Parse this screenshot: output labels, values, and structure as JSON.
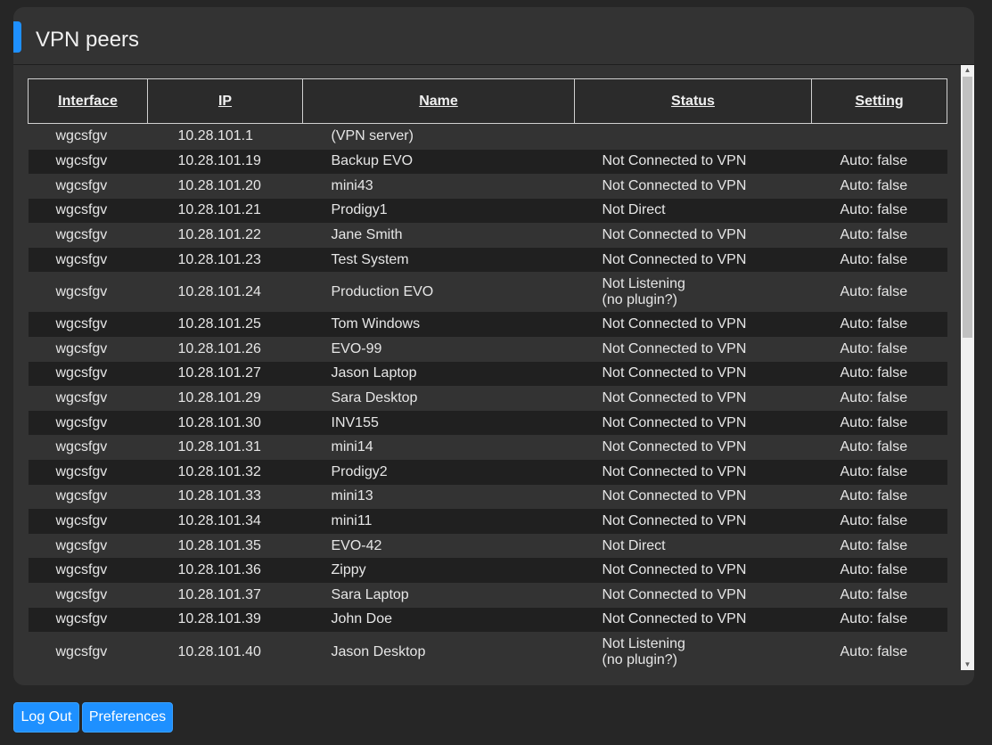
{
  "colors": {
    "accent": "#1e90ff",
    "button": "#1e90ff"
  },
  "panel": {
    "title": "VPN peers"
  },
  "table": {
    "headers": [
      "Interface",
      "IP",
      "Name",
      "Status",
      "Setting"
    ],
    "rows": [
      [
        "wgcsfgv",
        "10.28.101.1",
        "(VPN server)",
        "",
        ""
      ],
      [
        "wgcsfgv",
        "10.28.101.19",
        "Backup EVO",
        "Not Connected to VPN",
        "Auto: false"
      ],
      [
        "wgcsfgv",
        "10.28.101.20",
        "mini43",
        "Not Connected to VPN",
        "Auto: false"
      ],
      [
        "wgcsfgv",
        "10.28.101.21",
        "Prodigy1",
        "Not Direct",
        "Auto: false"
      ],
      [
        "wgcsfgv",
        "10.28.101.22",
        "Jane Smith",
        "Not Connected to VPN",
        "Auto: false"
      ],
      [
        "wgcsfgv",
        "10.28.101.23",
        "Test System",
        "Not Connected to VPN",
        "Auto: false"
      ],
      [
        "wgcsfgv",
        "10.28.101.24",
        "Production EVO",
        "Not Listening (no plugin?)",
        "Auto: false"
      ],
      [
        "wgcsfgv",
        "10.28.101.25",
        "Tom Windows",
        "Not Connected to VPN",
        "Auto: false"
      ],
      [
        "wgcsfgv",
        "10.28.101.26",
        "EVO-99",
        "Not Connected to VPN",
        "Auto: false"
      ],
      [
        "wgcsfgv",
        "10.28.101.27",
        "Jason Laptop",
        "Not Connected to VPN",
        "Auto: false"
      ],
      [
        "wgcsfgv",
        "10.28.101.29",
        "Sara Desktop",
        "Not Connected to VPN",
        "Auto: false"
      ],
      [
        "wgcsfgv",
        "10.28.101.30",
        "INV155",
        "Not Connected to VPN",
        "Auto: false"
      ],
      [
        "wgcsfgv",
        "10.28.101.31",
        "mini14",
        "Not Connected to VPN",
        "Auto: false"
      ],
      [
        "wgcsfgv",
        "10.28.101.32",
        "Prodigy2",
        "Not Connected to VPN",
        "Auto: false"
      ],
      [
        "wgcsfgv",
        "10.28.101.33",
        "mini13",
        "Not Connected to VPN",
        "Auto: false"
      ],
      [
        "wgcsfgv",
        "10.28.101.34",
        "mini11",
        "Not Connected to VPN",
        "Auto: false"
      ],
      [
        "wgcsfgv",
        "10.28.101.35",
        "EVO-42",
        "Not Direct",
        "Auto: false"
      ],
      [
        "wgcsfgv",
        "10.28.101.36",
        "Zippy",
        "Not Connected to VPN",
        "Auto: false"
      ],
      [
        "wgcsfgv",
        "10.28.101.37",
        "Sara Laptop",
        "Not Connected to VPN",
        "Auto: false"
      ],
      [
        "wgcsfgv",
        "10.28.101.39",
        "John Doe",
        "Not Connected to VPN",
        "Auto: false"
      ],
      [
        "wgcsfgv",
        "10.28.101.40",
        "Jason Desktop",
        "Not Listening (no plugin?)",
        "Auto: false"
      ]
    ]
  },
  "buttons": {
    "logout": "Log Out",
    "preferences": "Preferences"
  },
  "icons": {
    "scroll_up": "scroll-up-arrow-icon",
    "scroll_down": "scroll-down-arrow-icon"
  }
}
